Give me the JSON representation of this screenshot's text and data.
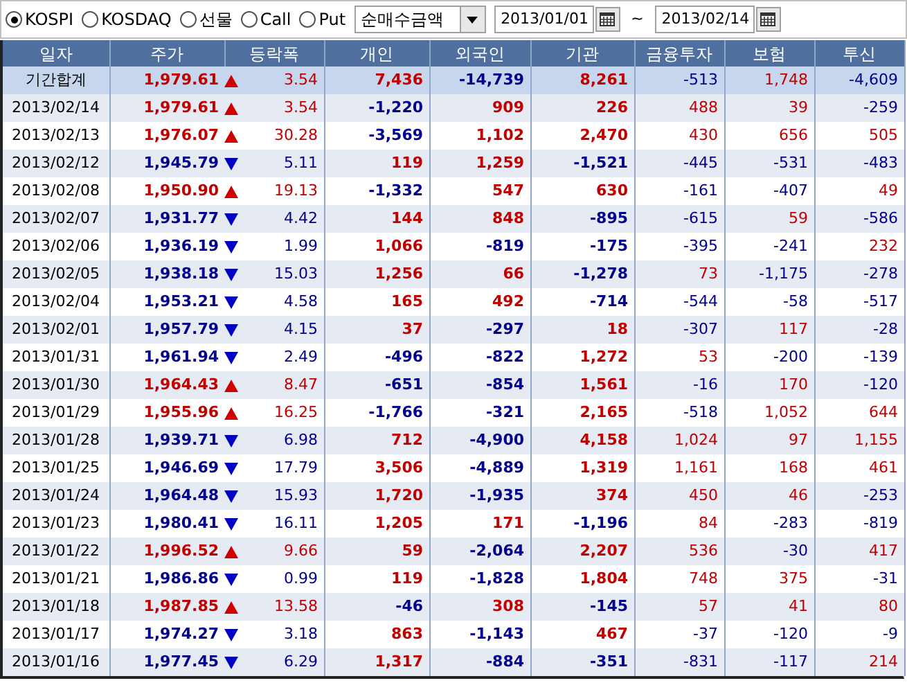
{
  "toolbar": {
    "markets": [
      {
        "label": "KOSPI",
        "selected": true
      },
      {
        "label": "KOSDAQ",
        "selected": false
      },
      {
        "label": "선물",
        "selected": false
      },
      {
        "label": "Call",
        "selected": false
      },
      {
        "label": "Put",
        "selected": false
      }
    ],
    "measure": "순매수금액",
    "date_from": "2013/01/01",
    "date_separator": "~",
    "date_to": "2013/02/14"
  },
  "table": {
    "columns": [
      "일자",
      "주가",
      "등락폭",
      "개인",
      "외국인",
      "기관",
      "금융투자",
      "보험",
      "투신"
    ],
    "summary": {
      "date": "기간합계",
      "price": "1,979.61",
      "kind": "up",
      "change": "3.54",
      "values": [
        "7,436",
        "-14,739",
        "8,261",
        "-513",
        "1,748",
        "-4,609"
      ]
    },
    "rows": [
      {
        "date": "2013/02/14",
        "price": "1,979.61",
        "kind": "up",
        "change": "3.54",
        "values": [
          "-1,220",
          "909",
          "226",
          "488",
          "39",
          "-259"
        ]
      },
      {
        "date": "2013/02/13",
        "price": "1,976.07",
        "kind": "up",
        "change": "30.28",
        "values": [
          "-3,569",
          "1,102",
          "2,470",
          "430",
          "656",
          "505"
        ]
      },
      {
        "date": "2013/02/12",
        "price": "1,945.79",
        "kind": "down",
        "change": "5.11",
        "values": [
          "119",
          "1,259",
          "-1,521",
          "-445",
          "-531",
          "-483"
        ]
      },
      {
        "date": "2013/02/08",
        "price": "1,950.90",
        "kind": "up",
        "change": "19.13",
        "values": [
          "-1,332",
          "547",
          "630",
          "-161",
          "-407",
          "49"
        ]
      },
      {
        "date": "2013/02/07",
        "price": "1,931.77",
        "kind": "down",
        "change": "4.42",
        "values": [
          "144",
          "848",
          "-895",
          "-615",
          "59",
          "-586"
        ]
      },
      {
        "date": "2013/02/06",
        "price": "1,936.19",
        "kind": "down",
        "change": "1.99",
        "values": [
          "1,066",
          "-819",
          "-175",
          "-395",
          "-241",
          "232"
        ]
      },
      {
        "date": "2013/02/05",
        "price": "1,938.18",
        "kind": "down",
        "change": "15.03",
        "values": [
          "1,256",
          "66",
          "-1,278",
          "73",
          "-1,175",
          "-278"
        ]
      },
      {
        "date": "2013/02/04",
        "price": "1,953.21",
        "kind": "down",
        "change": "4.58",
        "values": [
          "165",
          "492",
          "-714",
          "-544",
          "-58",
          "-517"
        ]
      },
      {
        "date": "2013/02/01",
        "price": "1,957.79",
        "kind": "down",
        "change": "4.15",
        "values": [
          "37",
          "-297",
          "18",
          "-307",
          "117",
          "-28"
        ]
      },
      {
        "date": "2013/01/31",
        "price": "1,961.94",
        "kind": "down",
        "change": "2.49",
        "values": [
          "-496",
          "-822",
          "1,272",
          "53",
          "-200",
          "-139"
        ]
      },
      {
        "date": "2013/01/30",
        "price": "1,964.43",
        "kind": "up",
        "change": "8.47",
        "values": [
          "-651",
          "-854",
          "1,561",
          "-16",
          "170",
          "-120"
        ]
      },
      {
        "date": "2013/01/29",
        "price": "1,955.96",
        "kind": "up",
        "change": "16.25",
        "values": [
          "-1,766",
          "-321",
          "2,165",
          "-518",
          "1,052",
          "644"
        ]
      },
      {
        "date": "2013/01/28",
        "price": "1,939.71",
        "kind": "down",
        "change": "6.98",
        "values": [
          "712",
          "-4,900",
          "4,158",
          "1,024",
          "97",
          "1,155"
        ]
      },
      {
        "date": "2013/01/25",
        "price": "1,946.69",
        "kind": "down",
        "change": "17.79",
        "values": [
          "3,506",
          "-4,889",
          "1,319",
          "1,161",
          "168",
          "461"
        ]
      },
      {
        "date": "2013/01/24",
        "price": "1,964.48",
        "kind": "down",
        "change": "15.93",
        "values": [
          "1,720",
          "-1,935",
          "374",
          "450",
          "46",
          "-253"
        ]
      },
      {
        "date": "2013/01/23",
        "price": "1,980.41",
        "kind": "down",
        "change": "16.11",
        "values": [
          "1,205",
          "171",
          "-1,196",
          "84",
          "-283",
          "-819"
        ]
      },
      {
        "date": "2013/01/22",
        "price": "1,996.52",
        "kind": "up",
        "change": "9.66",
        "values": [
          "59",
          "-2,064",
          "2,207",
          "536",
          "-30",
          "417"
        ]
      },
      {
        "date": "2013/01/21",
        "price": "1,986.86",
        "kind": "down",
        "change": "0.99",
        "values": [
          "119",
          "-1,828",
          "1,804",
          "748",
          "375",
          "-31"
        ]
      },
      {
        "date": "2013/01/18",
        "price": "1,987.85",
        "kind": "up",
        "change": "13.58",
        "values": [
          "-46",
          "308",
          "-145",
          "57",
          "41",
          "80"
        ]
      },
      {
        "date": "2013/01/17",
        "price": "1,974.27",
        "kind": "down",
        "change": "3.18",
        "values": [
          "863",
          "-1,143",
          "467",
          "-37",
          "-120",
          "-9"
        ]
      },
      {
        "date": "2013/01/16",
        "price": "1,977.45",
        "kind": "down",
        "change": "6.29",
        "values": [
          "1,317",
          "-884",
          "-351",
          "-831",
          "-117",
          "214"
        ]
      }
    ]
  }
}
